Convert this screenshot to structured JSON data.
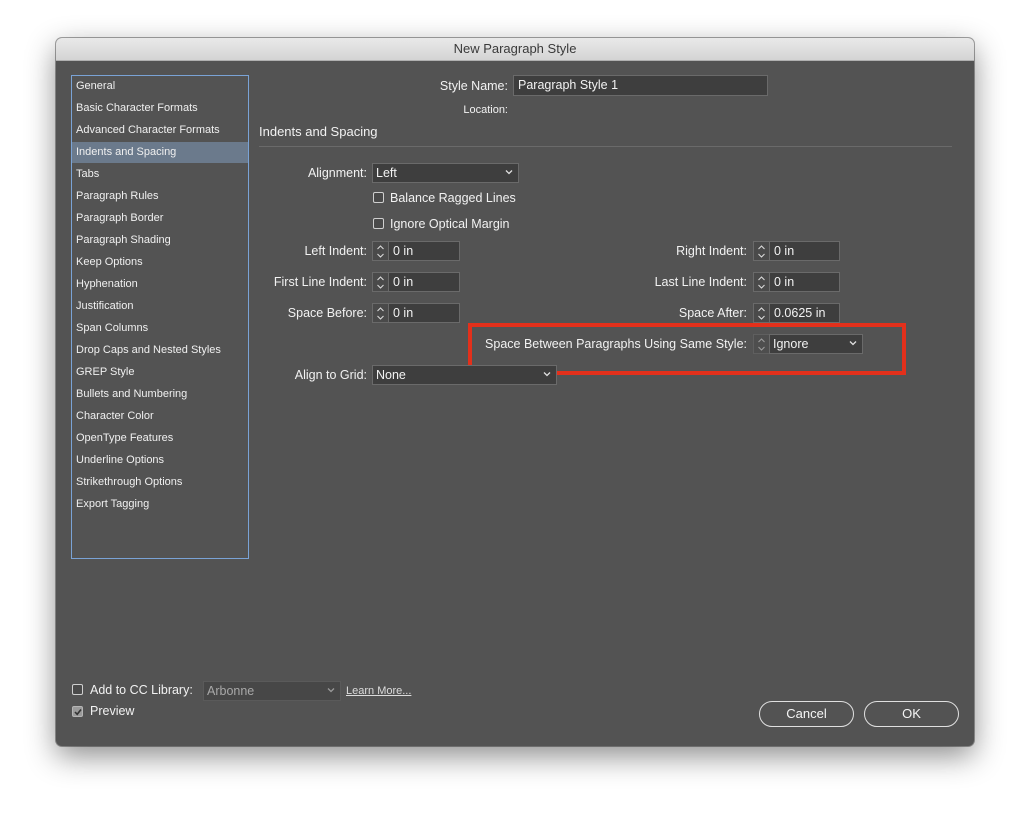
{
  "window": {
    "title": "New Paragraph Style"
  },
  "sidebar": {
    "items": [
      {
        "label": "General"
      },
      {
        "label": "Basic Character Formats"
      },
      {
        "label": "Advanced Character Formats"
      },
      {
        "label": "Indents and Spacing"
      },
      {
        "label": "Tabs"
      },
      {
        "label": "Paragraph Rules"
      },
      {
        "label": "Paragraph Border"
      },
      {
        "label": "Paragraph Shading"
      },
      {
        "label": "Keep Options"
      },
      {
        "label": "Hyphenation"
      },
      {
        "label": "Justification"
      },
      {
        "label": "Span Columns"
      },
      {
        "label": "Drop Caps and Nested Styles"
      },
      {
        "label": "GREP Style"
      },
      {
        "label": "Bullets and Numbering"
      },
      {
        "label": "Character Color"
      },
      {
        "label": "OpenType Features"
      },
      {
        "label": "Underline Options"
      },
      {
        "label": "Strikethrough Options"
      },
      {
        "label": "Export Tagging"
      }
    ],
    "selected": "Indents and Spacing"
  },
  "header": {
    "style_name_label": "Style Name:",
    "style_name_value": "Paragraph Style 1",
    "location_label": "Location:",
    "section_title": "Indents and Spacing"
  },
  "form": {
    "alignment_label": "Alignment:",
    "alignment_value": "Left",
    "balance_ragged_label": "Balance Ragged Lines",
    "ignore_optical_label": "Ignore Optical Margin",
    "left_indent_label": "Left Indent:",
    "left_indent_value": "0 in",
    "right_indent_label": "Right Indent:",
    "right_indent_value": "0 in",
    "first_line_label": "First Line Indent:",
    "first_line_value": "0 in",
    "last_line_label": "Last Line Indent:",
    "last_line_value": "0 in",
    "space_before_label": "Space Before:",
    "space_before_value": "0 in",
    "space_after_label": "Space After:",
    "space_after_value": "0.0625 in",
    "space_between_label": "Space Between Paragraphs Using Same Style:",
    "space_between_value": "Ignore",
    "align_grid_label": "Align to Grid:",
    "align_grid_value": "None"
  },
  "footer": {
    "cc_library_label": "Add to CC Library:",
    "cc_library_value": "Arbonne",
    "learn_more": "Learn More...",
    "preview_label": "Preview",
    "cancel_label": "Cancel",
    "ok_label": "OK"
  },
  "colors": {
    "dialog_bg": "#535353",
    "selection": "#6b7a8c",
    "highlight_box": "#e3301b",
    "sidebar_border": "#7aa3d6"
  }
}
